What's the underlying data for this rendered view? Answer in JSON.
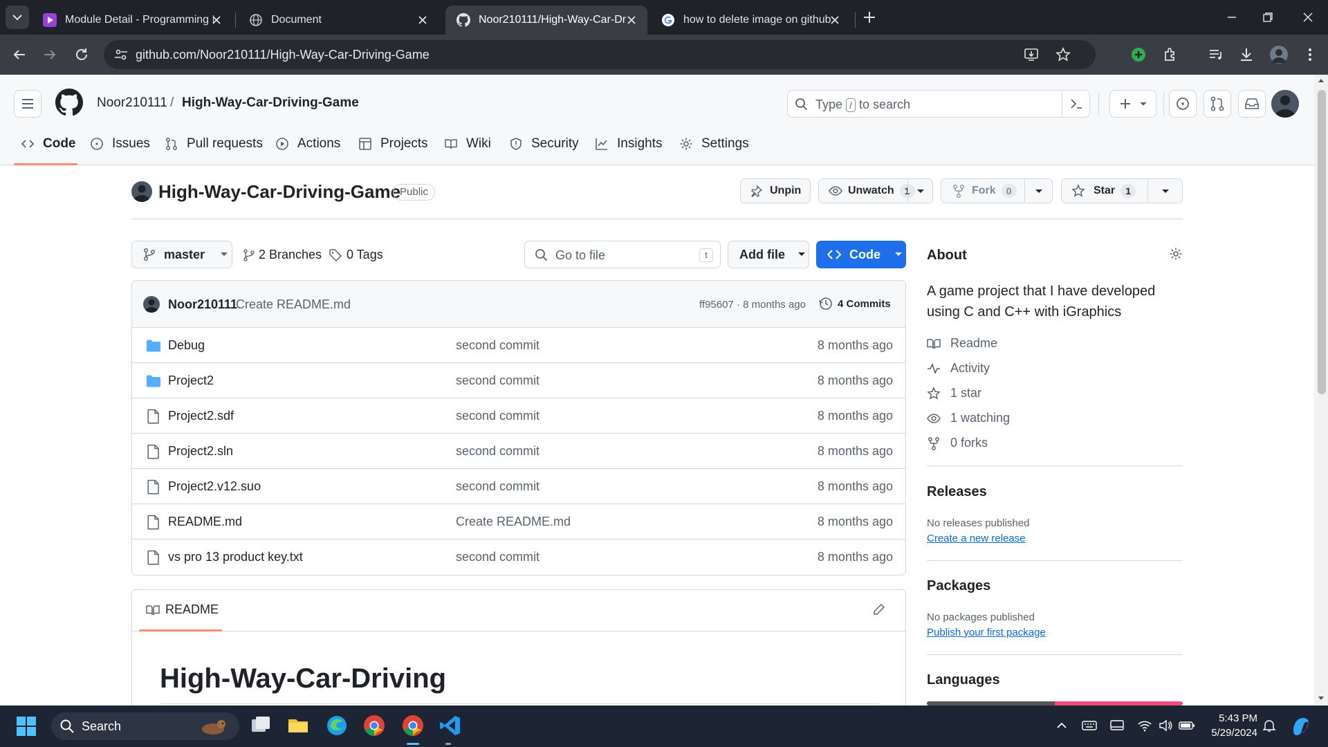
{
  "browser": {
    "tabs": [
      {
        "title": "Module Detail - Programming I"
      },
      {
        "title": "Document"
      },
      {
        "title": "Noor210111/High-Way-Car-Dr"
      },
      {
        "title": "how to delete image on github"
      }
    ],
    "url": "github.com/Noor210111/High-Way-Car-Driving-Game"
  },
  "github": {
    "owner": "Noor210111",
    "separator": "/",
    "repo": "High-Way-Car-Driving-Game",
    "search": {
      "before": "Type",
      "key": "/",
      "after": "to search"
    },
    "nav": [
      "Code",
      "Issues",
      "Pull requests",
      "Actions",
      "Projects",
      "Wiki",
      "Security",
      "Insights",
      "Settings"
    ]
  },
  "repo": {
    "title": "High-Way-Car-Driving-Game",
    "visibility": "Public",
    "unpin_label": "Unpin",
    "unwatch_label": "Unwatch",
    "watch_count": "1",
    "fork_label": "Fork",
    "fork_count": "0",
    "star_label": "Star",
    "star_count": "1"
  },
  "code_toolbar": {
    "branch": "master",
    "branches": "2 Branches",
    "tags": "0 Tags",
    "goto_placeholder": "Go to file",
    "goto_key": "t",
    "add_file": "Add file",
    "code": "Code"
  },
  "commit": {
    "author": "Noor210111",
    "message": "Create README.md",
    "meta": "ff95607 · 8 months ago",
    "commits": "4 Commits"
  },
  "files": [
    {
      "name": "Debug",
      "type": "folder",
      "message": "second commit",
      "age": "8 months ago"
    },
    {
      "name": "Project2",
      "type": "folder",
      "message": "second commit",
      "age": "8 months ago"
    },
    {
      "name": "Project2.sdf",
      "type": "file",
      "message": "second commit",
      "age": "8 months ago"
    },
    {
      "name": "Project2.sln",
      "type": "file",
      "message": "second commit",
      "age": "8 months ago"
    },
    {
      "name": "Project2.v12.suo",
      "type": "file",
      "message": "second commit",
      "age": "8 months ago"
    },
    {
      "name": "README.md",
      "type": "file",
      "message": "Create README.md",
      "age": "8 months ago"
    },
    {
      "name": "vs pro 13 product key.txt",
      "type": "file",
      "message": "second commit",
      "age": "8 months ago"
    }
  ],
  "readme": {
    "tab_label": "README",
    "heading": "High-Way-Car-Driving"
  },
  "about": {
    "title": "About",
    "description_line1": "A game project that I have developed",
    "description_line2": "using C and C++ with iGraphics",
    "readme": "Readme",
    "activity": "Activity",
    "stars": "1 star",
    "watching": "1 watching",
    "forks": "0 forks"
  },
  "releases": {
    "title": "Releases",
    "none": "No releases published",
    "link": "Create a new release"
  },
  "packages": {
    "title": "Packages",
    "none": "No packages published",
    "link": "Publish your first package"
  },
  "languages": {
    "title": "Languages",
    "colors": [
      "#555555",
      "#f34b7d"
    ]
  },
  "taskbar": {
    "search_label": "Search",
    "time": "5:43 PM",
    "date": "5/29/2024"
  },
  "colors": {
    "accent_blue": "#1f6feb",
    "link_blue": "#0969da",
    "folder_blue": "#54aeff",
    "nav_underline": "#fd8c73"
  }
}
